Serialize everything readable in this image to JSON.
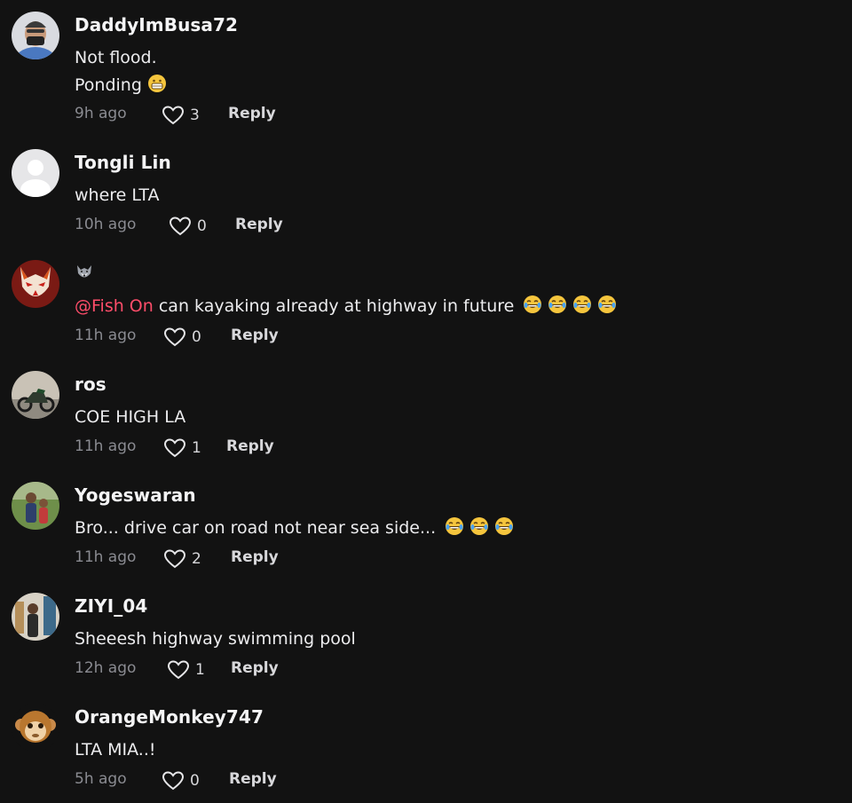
{
  "comments": [
    {
      "username": "DaddyImBusa72",
      "lines": [
        "Not flood.",
        "Ponding"
      ],
      "time": "9h ago",
      "likes": "3",
      "reply_label": "Reply"
    },
    {
      "username": "Tongli Lin",
      "lines": [
        "where LTA"
      ],
      "time": "10h ago",
      "likes": "0",
      "reply_label": "Reply"
    },
    {
      "username": "",
      "mention": "@Fish On",
      "lines": [
        " can kayaking already at highway in future"
      ],
      "time": "11h ago",
      "likes": "0",
      "reply_label": "Reply"
    },
    {
      "username": "ros",
      "lines": [
        "COE HIGH LA"
      ],
      "time": "11h ago",
      "likes": "1",
      "reply_label": "Reply"
    },
    {
      "username": "Yogeswaran",
      "lines": [
        "Bro... drive car on road not near sea side..."
      ],
      "time": "11h ago",
      "likes": "2",
      "reply_label": "Reply"
    },
    {
      "username": "ZIYI_04",
      "lines": [
        "Sheeesh highway swimming pool"
      ],
      "time": "12h ago",
      "likes": "1",
      "reply_label": "Reply"
    },
    {
      "username": "OrangeMonkey747",
      "lines": [
        "LTA MIA..!"
      ],
      "time": "5h ago",
      "likes": "0",
      "reply_label": "Reply"
    }
  ],
  "icons": {
    "like": "heart-outline-icon",
    "grin": "grinning-face-emoji",
    "laugh": "face-with-tears-of-joy-emoji",
    "wolf": "wolf-emoji"
  },
  "colors": {
    "background": "#121212",
    "mention": "#ff4d6a",
    "muted": "#8a8b91"
  }
}
